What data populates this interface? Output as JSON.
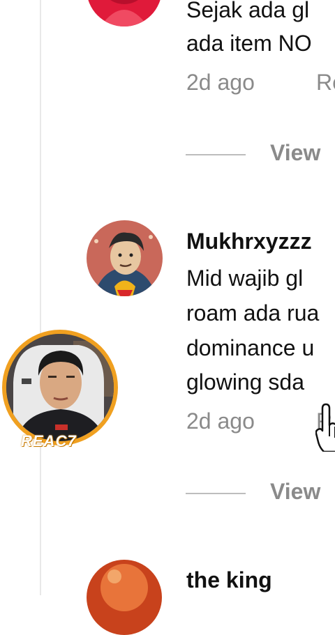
{
  "thread": {
    "comments": [
      {
        "username": "",
        "lines": [
          "Sejak ada gl",
          "ada item NO"
        ],
        "time": "2d ago",
        "reply_label": "Re",
        "view_label": "View"
      },
      {
        "username": "Mukhrxyzzz",
        "lines": [
          "Mid wajib gl",
          "roam ada rua",
          "dominance u",
          "glowing sda"
        ],
        "time": "2d ago",
        "reply_label": "R",
        "view_label": "View"
      },
      {
        "username": "the king"
      }
    ]
  },
  "overlay": {
    "brand_label": "REAC7"
  },
  "colors": {
    "muted_text": "#8a8a8a",
    "ring_accent": "#f0a020",
    "rail": "#e8e8e8"
  }
}
